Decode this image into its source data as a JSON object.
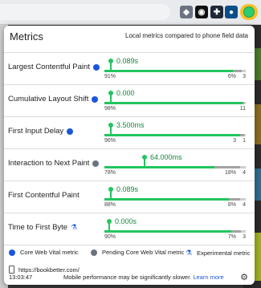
{
  "panel": {
    "title": "Metrics",
    "subtitle": "Local metrics compared to phone field data"
  },
  "colors": {
    "good": "#22c55e",
    "needs_improvement": "#a3a3a3",
    "poor": "#9ca3af",
    "core": "#1a56db",
    "pending": "#6b7280"
  },
  "metrics": [
    {
      "name": "Largest Contentful Paint",
      "value": "0.089s",
      "status": "core",
      "good_pct": "91%",
      "ni_pct": "6%",
      "poor_pct": "3",
      "good_frac": 0.91,
      "ni_frac": 0.06,
      "marker_frac": 0.04
    },
    {
      "name": "Cumulative Layout Shift",
      "value": "0.000",
      "status": "core",
      "good_pct": "98%",
      "ni_pct": "",
      "poor_pct": "11",
      "good_frac": 0.98,
      "ni_frac": 0.01,
      "marker_frac": 0.04
    },
    {
      "name": "First Input Delay",
      "value": "3.500ms",
      "status": "core",
      "good_pct": "96%",
      "ni_pct": "3",
      "poor_pct": "1",
      "good_frac": 0.96,
      "ni_frac": 0.03,
      "marker_frac": 0.04
    },
    {
      "name": "Interaction to Next Paint",
      "value": "64.000ms",
      "status": "pending",
      "good_pct": "78%",
      "ni_pct": "18%",
      "poor_pct": "4",
      "good_frac": 0.78,
      "ni_frac": 0.18,
      "marker_frac": 0.28
    },
    {
      "name": "First Contentful Paint",
      "value": "0.089s",
      "status": "none",
      "good_pct": "88%",
      "ni_pct": "8%",
      "poor_pct": "4",
      "good_frac": 0.88,
      "ni_frac": 0.08,
      "marker_frac": 0.04
    },
    {
      "name": "Time to First Byte",
      "value": "0.000s",
      "status": "experimental",
      "good_pct": "90%",
      "ni_pct": "7%",
      "poor_pct": "3",
      "good_frac": 0.9,
      "ni_frac": 0.07,
      "marker_frac": 0.03
    }
  ],
  "legend": {
    "core": "Core Web Vital metric",
    "pending": "Pending Core Web Vital metric",
    "experimental": "Experimental metric"
  },
  "url": "https://bookbetter.com/",
  "footer": {
    "time": "13:03:47",
    "note": "Mobile performance may be significantly slower.",
    "learn_more": "Learn more"
  }
}
